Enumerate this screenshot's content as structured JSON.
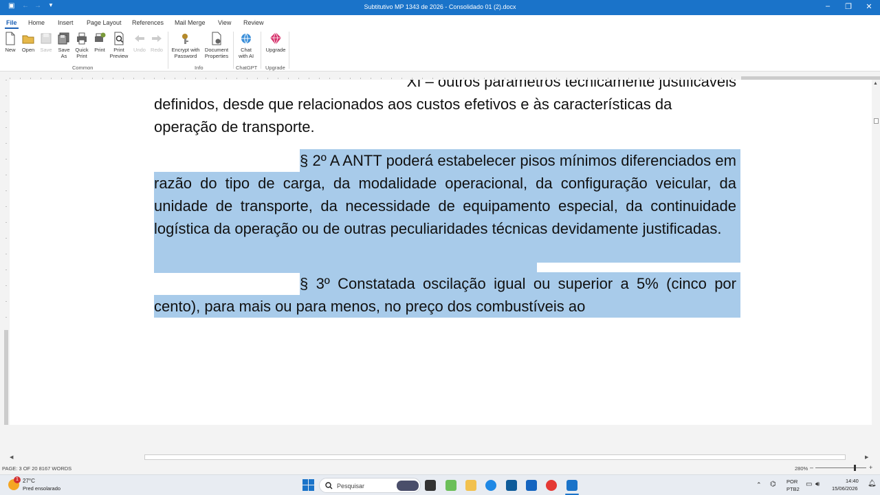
{
  "window": {
    "title": "Subtitutivo MP 1343 de 2026 - Consolidado 01 (2).docx"
  },
  "menu": {
    "tabs": [
      "File",
      "Home",
      "Insert",
      "Page Layout",
      "References",
      "Mail Merge",
      "View",
      "Review"
    ]
  },
  "ribbon": {
    "buttons": {
      "new": "New",
      "open": "Open",
      "save": "Save",
      "save_as_1": "Save",
      "save_as_2": "As",
      "quick_print_1": "Quick",
      "quick_print_2": "Print",
      "print": "Print",
      "print_preview_1": "Print",
      "print_preview_2": "Preview",
      "undo": "Undo",
      "redo": "Redo",
      "encrypt_1": "Encrypt with",
      "encrypt_2": "Password",
      "docprops_1": "Document",
      "docprops_2": "Properties",
      "chat_1": "Chat",
      "chat_2": "with AI",
      "upgrade": "Upgrade"
    },
    "groups": {
      "common": "Common",
      "info": "Info",
      "chatgpt": "ChatGPT",
      "upgrade": "Upgrade"
    }
  },
  "document": {
    "para0_line1": "XI – outros parâmetros tecnicamente justificáveis",
    "para0_line2": "definidos, desde que relacionados aos custos efetivos e às características da operação de transporte.",
    "para1": "§ 2º A ANTT poderá estabelecer pisos mínimos diferenciados em razão do tipo de carga, da modalidade operacional, da configuração veicular, da unidade de transporte, da necessidade de equipamento especial, da continuidade logística da operação ou de outras peculiaridades técnicas devidamente justificadas.",
    "para2": "§ 3º Constatada oscilação igual ou superior a 5% (cinco por cento), para mais ou para menos, no preço dos combustíveis ao"
  },
  "status": {
    "pages": "PAGE: 3 OF 20  8167 WORDS",
    "zoom": "280%"
  },
  "taskbar": {
    "weather_temp": "27°C",
    "weather_desc": "Pred ensolarado",
    "weather_badge": "1",
    "search_placeholder": "Pesquisar",
    "lang_1": "POR",
    "lang_2": "PTB2",
    "time": "14:40",
    "date": "15/06/2026"
  },
  "colors": {
    "titlebar": "#1a73c9",
    "selection": "#a8cbea",
    "accent": "#1a5fb4"
  }
}
